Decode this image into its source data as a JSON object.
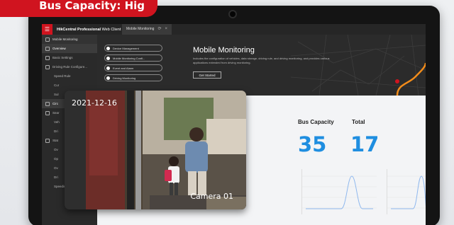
{
  "promo_banner": {
    "text": "Bus Capacity: Hig"
  },
  "app": {
    "title_bold": "HikCentral Professional",
    "title_rest": " Web Client",
    "active_tab": "Mobile Monitoring"
  },
  "sidebar": {
    "header": "Mobile Monitoring",
    "items": [
      {
        "label": "Overview"
      },
      {
        "label": "Basic Settings"
      },
      {
        "label": "Driving Rule Configure..."
      },
      {
        "label": "Speed Rule"
      },
      {
        "label": "Cur"
      },
      {
        "label": "Sul"
      },
      {
        "label": "Circ"
      },
      {
        "label": "Sear"
      },
      {
        "label": "Veh"
      },
      {
        "label": "Dri"
      },
      {
        "label": "Stat"
      },
      {
        "label": "Ov"
      },
      {
        "label": "Op"
      },
      {
        "label": "Ov"
      },
      {
        "label": "Dri"
      },
      {
        "label": "Speeding"
      }
    ]
  },
  "hero": {
    "pills": [
      "Device Management",
      "Mobile Monitoring Confi...",
      "Event and Alarm",
      "Driving Monitoring"
    ],
    "title": "Mobile Monitoring",
    "description": "Includes the configuration of vehicles, data storage, driving rule, and driving monitoring, and provides various applications extended from driving monitoring.",
    "button": "Get Started"
  },
  "stats": [
    {
      "label": "Bus Capacity",
      "value": "35"
    },
    {
      "label": "Total",
      "value": "17"
    }
  ],
  "camera_overlay": {
    "date": "2021-12-16",
    "camera": "Camera 01"
  },
  "colors": {
    "accent": "#d0141f",
    "stat_blue": "#1f8ee0",
    "route_orange": "#f28c1a"
  }
}
